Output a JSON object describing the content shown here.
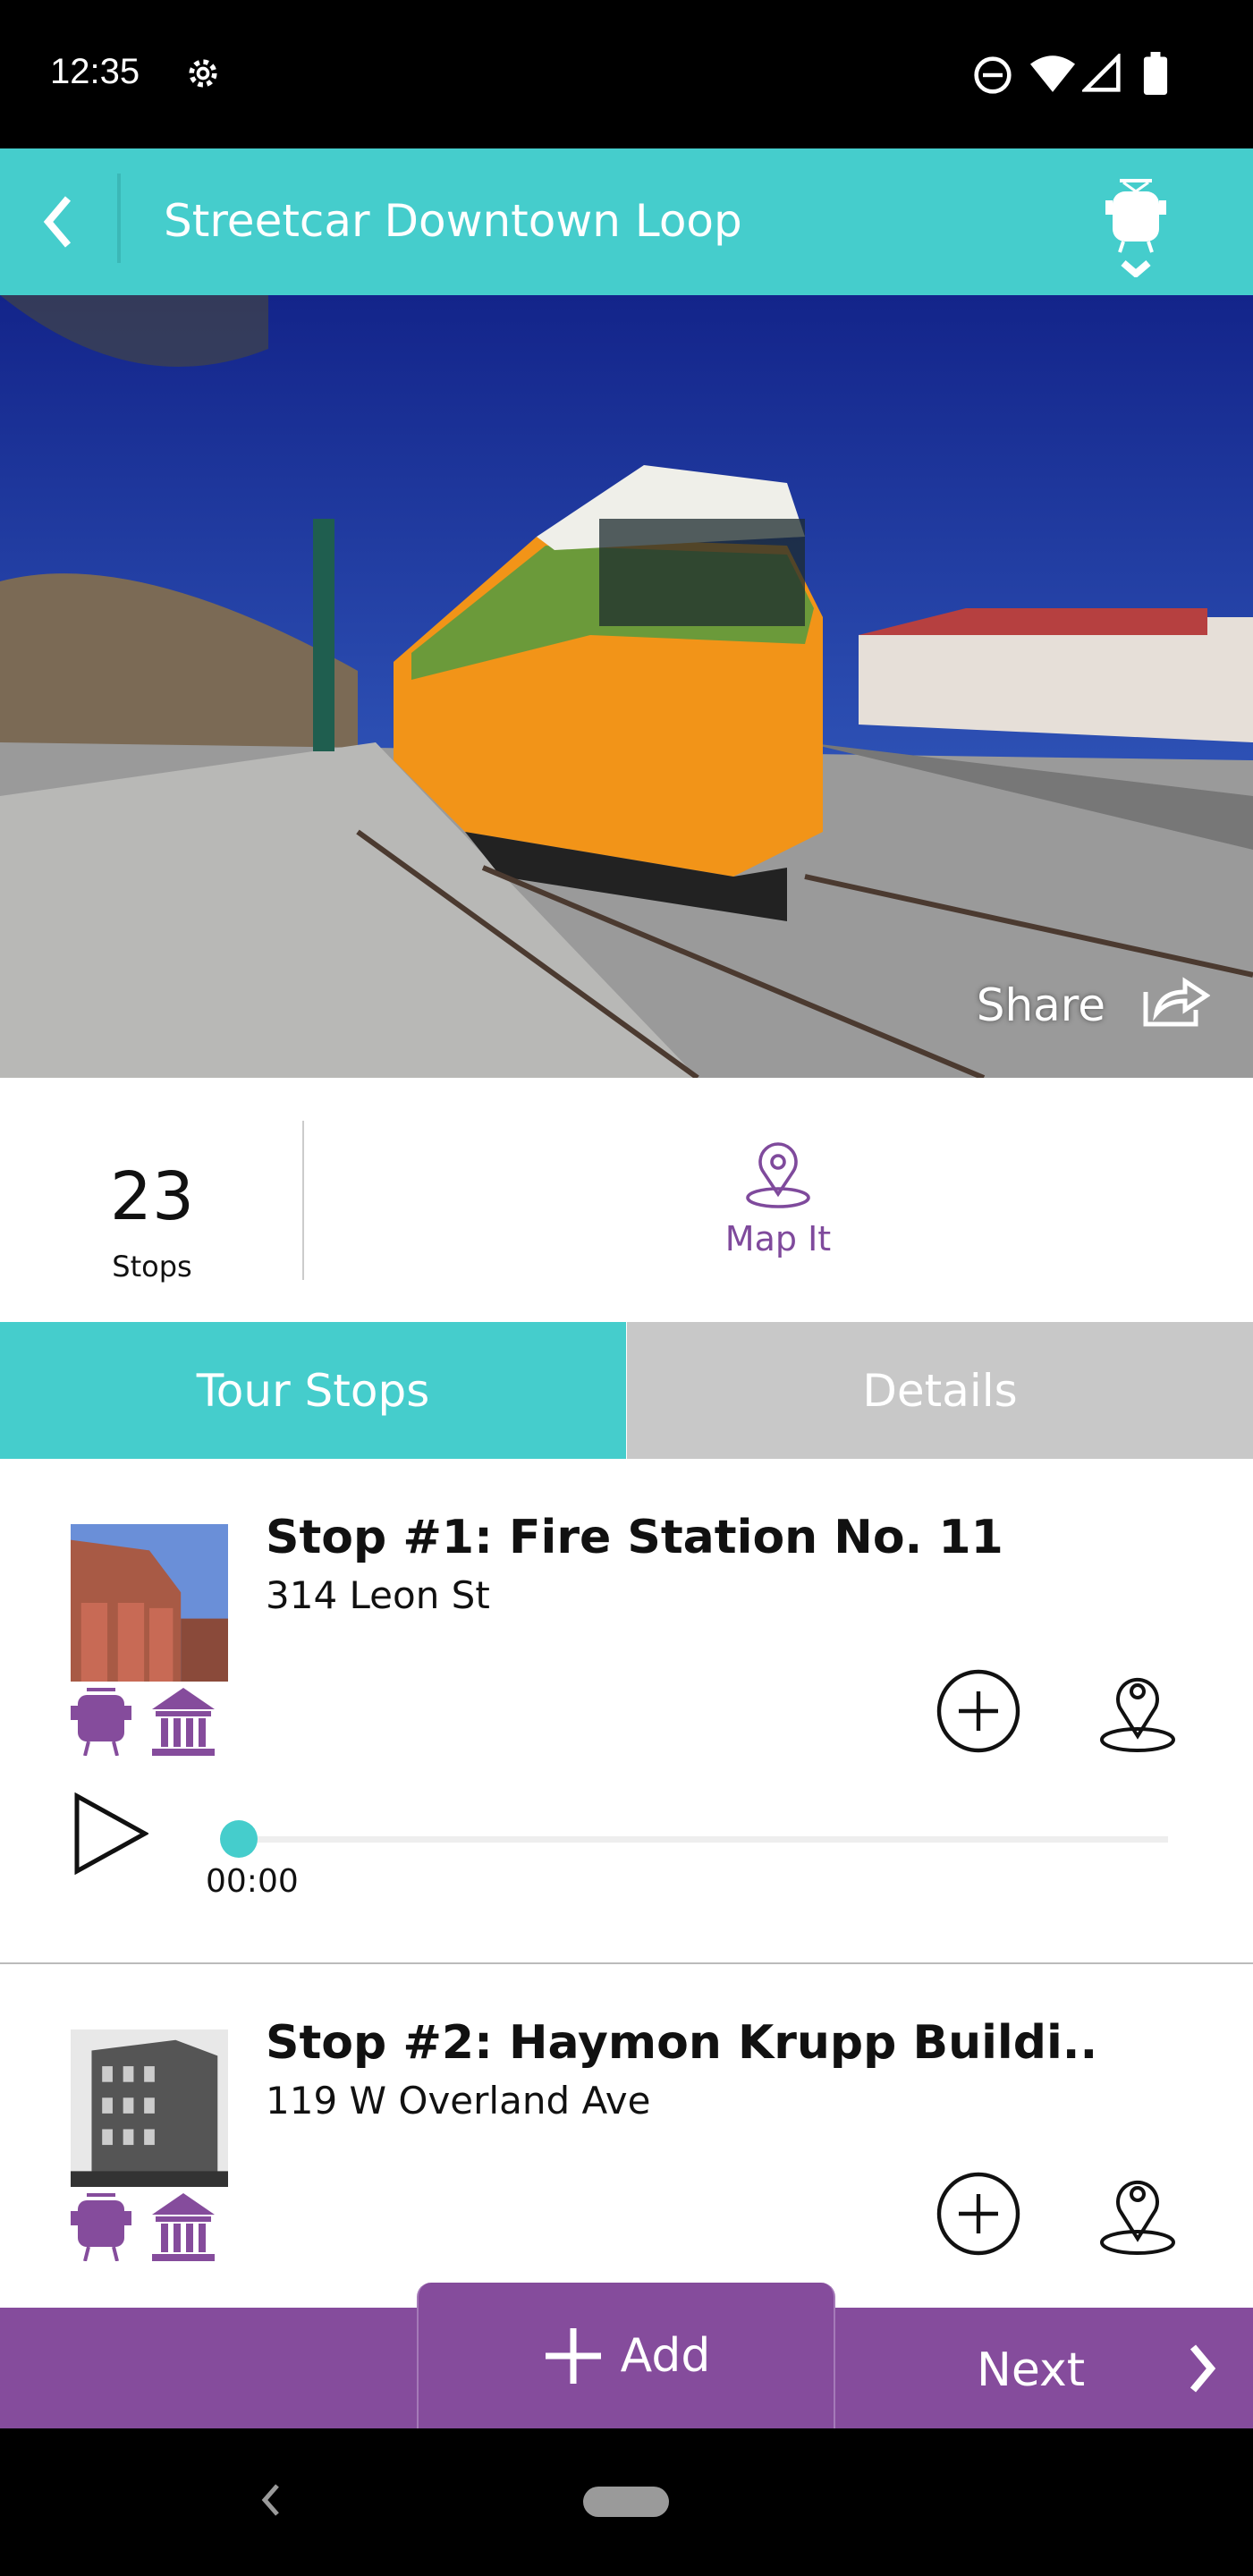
{
  "status_bar": {
    "time": "12:35",
    "icons": [
      "settings-icon",
      "dnd-icon",
      "wifi-icon",
      "signal-icon",
      "battery-icon"
    ]
  },
  "header": {
    "title": "Streetcar Downtown Loop",
    "back_icon": "chevron-left-icon",
    "mode_icon": "streetcar-icon"
  },
  "hero": {
    "share_label": "Share"
  },
  "stats": {
    "stops_count": "23",
    "stops_label": "Stops",
    "map_label": "Map It"
  },
  "tabs": [
    {
      "label": "Tour Stops",
      "active": true
    },
    {
      "label": "Details",
      "active": false
    }
  ],
  "colors": {
    "teal": "#45cdcc",
    "purple": "#854c9c",
    "tab_inactive": "#c8c8c8"
  },
  "stops": [
    {
      "title": "Stop #1:  Fire Station No. 11",
      "address": "314 Leon St",
      "time": "00:00",
      "progress": 0
    },
    {
      "title": "Stop #2:  Haymon Krupp Buildi..",
      "address": "119 W Overland Ave"
    }
  ],
  "bottom": {
    "add_label": "Add",
    "next_label": "Next"
  }
}
